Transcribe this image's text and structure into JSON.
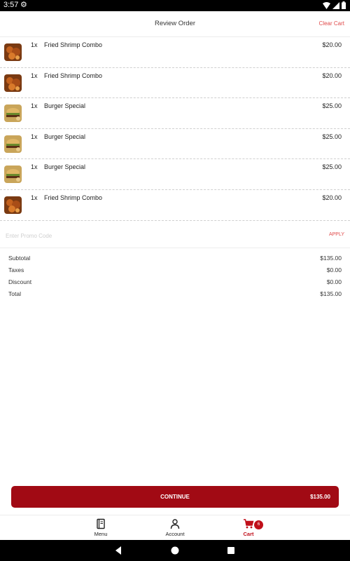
{
  "status_bar": {
    "time": "3:57"
  },
  "header": {
    "title": "Review Order",
    "clear_cart": "Clear Cart"
  },
  "items": [
    {
      "qty": "1x",
      "name": "Fried Shrimp Combo",
      "price": "$20.00",
      "image": "fried-shrimp-combo"
    },
    {
      "qty": "1x",
      "name": "Fried Shrimp Combo",
      "price": "$20.00",
      "image": "fried-shrimp-combo"
    },
    {
      "qty": "1x",
      "name": "Burger Special",
      "price": "$25.00",
      "image": "burger-special"
    },
    {
      "qty": "1x",
      "name": "Burger Special",
      "price": "$25.00",
      "image": "burger-special"
    },
    {
      "qty": "1x",
      "name": "Burger Special",
      "price": "$25.00",
      "image": "burger-special"
    },
    {
      "qty": "1x",
      "name": "Fried Shrimp Combo",
      "price": "$20.00",
      "image": "fried-shrimp-combo"
    }
  ],
  "promo": {
    "placeholder": "Enter Promo Code",
    "apply": "APPLY"
  },
  "summary": {
    "subtotal_label": "Subtotal",
    "subtotal": "$135.00",
    "taxes_label": "Taxes",
    "taxes": "$0.00",
    "discount_label": "Discount",
    "discount": "$0.00",
    "total_label": "Total",
    "total": "$135.00"
  },
  "continue": {
    "label": "CONTINUE",
    "total": "$135.00"
  },
  "nav": {
    "menu": "Menu",
    "account": "Account",
    "cart": "Cart",
    "cart_count": "6"
  },
  "colors": {
    "accent": "#a10a14",
    "link": "#e04a4a",
    "cart_active": "#c00f1a"
  }
}
